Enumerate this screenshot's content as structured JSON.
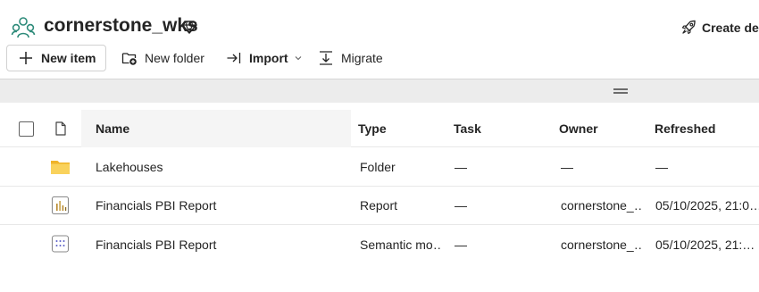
{
  "workspace": {
    "title": "cornerstone_wks",
    "icon": "workspace-people-icon",
    "badge_icon": "premium-diamond-icon"
  },
  "header_actions": {
    "create_deployment_label": "Create dep"
  },
  "toolbar": {
    "new_item_label": "New item",
    "new_folder_label": "New folder",
    "import_label": "Import",
    "migrate_label": "Migrate"
  },
  "table": {
    "columns": {
      "name": "Name",
      "type": "Type",
      "task": "Task",
      "owner": "Owner",
      "refreshed": "Refreshed"
    },
    "rows": [
      {
        "icon": "folder-icon",
        "name": "Lakehouses",
        "type": "Folder",
        "task": "—",
        "owner": "—",
        "refreshed": "—"
      },
      {
        "icon": "report-icon",
        "name": "Financials PBI Report",
        "type": "Report",
        "task": "—",
        "owner": "cornerstone_…",
        "refreshed": "05/10/2025, 21:0…"
      },
      {
        "icon": "semantic-model-icon",
        "name": "Financials PBI Report",
        "type": "Semantic mo…",
        "task": "—",
        "owner": "cornerstone_…",
        "refreshed": "05/10/2025, 21:…"
      }
    ]
  },
  "colors": {
    "folder": "#f5c842",
    "report_accent": "#c8a34a",
    "workspace_icon": "#2e8b7a",
    "band": "#ececec"
  }
}
